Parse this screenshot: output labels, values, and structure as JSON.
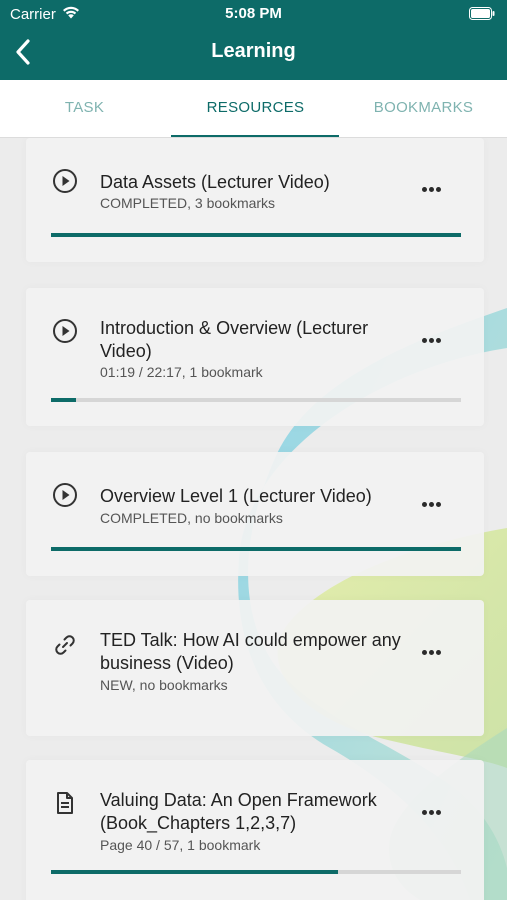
{
  "status_bar": {
    "carrier": "Carrier",
    "time": "5:08 PM"
  },
  "header": {
    "title": "Learning",
    "back_icon": "chevron-left-icon"
  },
  "tabs": [
    {
      "label": "TASK",
      "active": false
    },
    {
      "label": "RESOURCES",
      "active": true
    },
    {
      "label": "BOOKMARKS",
      "active": false
    }
  ],
  "resources": [
    {
      "icon": "play-icon",
      "title": "Data Assets (Lecturer Video)",
      "subtitle": "COMPLETED, 3 bookmarks",
      "progress": 1.0
    },
    {
      "icon": "play-icon",
      "title": "Introduction & Overview (Lecturer Video)",
      "subtitle": "01:19 / 22:17, 1 bookmark",
      "progress": 0.06
    },
    {
      "icon": "play-icon",
      "title": "Overview Level 1 (Lecturer Video)",
      "subtitle": "COMPLETED, no bookmarks",
      "progress": 1.0
    },
    {
      "icon": "link-icon",
      "title": "TED Talk: How AI could empower any business (Video)",
      "subtitle": "NEW, no bookmarks",
      "progress": null
    },
    {
      "icon": "document-icon",
      "title": "Valuing Data: An Open Framework (Book_Chapters 1,2,3,7)",
      "subtitle": "Page 40 / 57, 1 bookmark",
      "progress": 0.7
    }
  ],
  "colors": {
    "brand": "#0d6b68",
    "tab_inactive": "#7fb3b0",
    "progress_track": "#d6d6d6"
  }
}
